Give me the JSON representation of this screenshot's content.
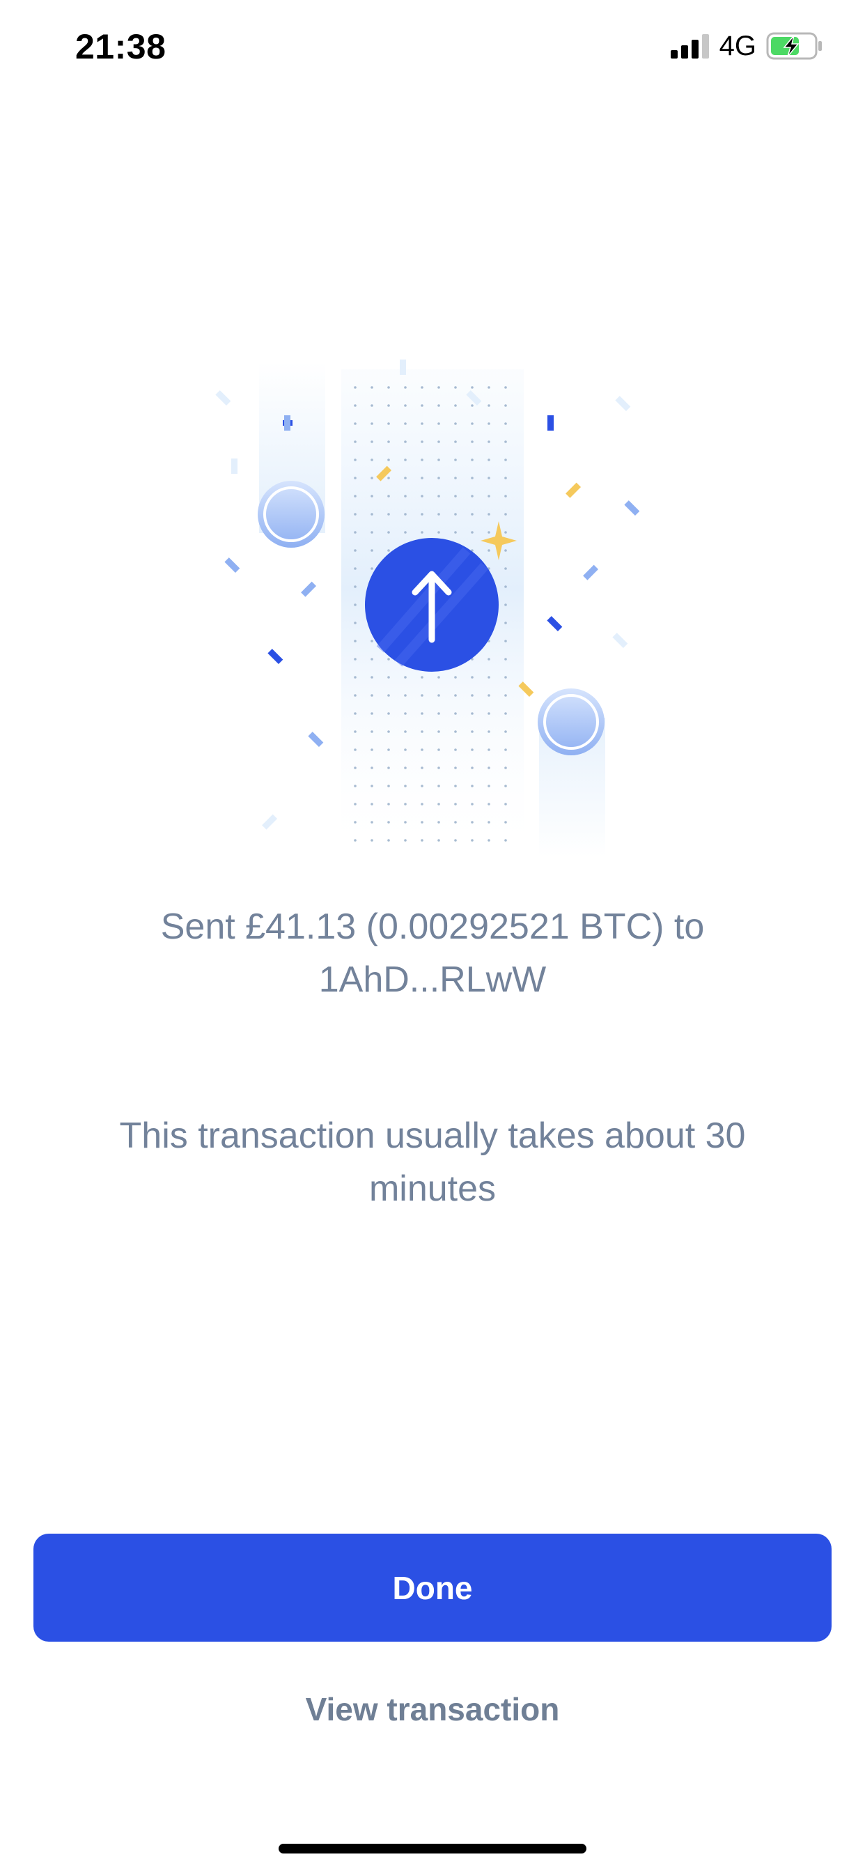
{
  "status_bar": {
    "time": "21:38",
    "network": "4G",
    "icons": [
      "signal-icon",
      "battery-charging-icon"
    ]
  },
  "illustration": {
    "icon": "arrow-up-icon",
    "colors": {
      "primary": "#2b50e4",
      "accent": "#f5c95c",
      "light": "#e6f1fc"
    }
  },
  "confirmation": {
    "sent_message": "Sent £41.13 (0.00292521 BTC) to 1AhD...RLwW",
    "duration_message": "This transaction usually takes about 30 minutes"
  },
  "actions": {
    "done_label": "Done",
    "view_transaction_label": "View transaction"
  },
  "colors": {
    "button_primary": "#2b50e4",
    "text_secondary": "#72829a"
  }
}
